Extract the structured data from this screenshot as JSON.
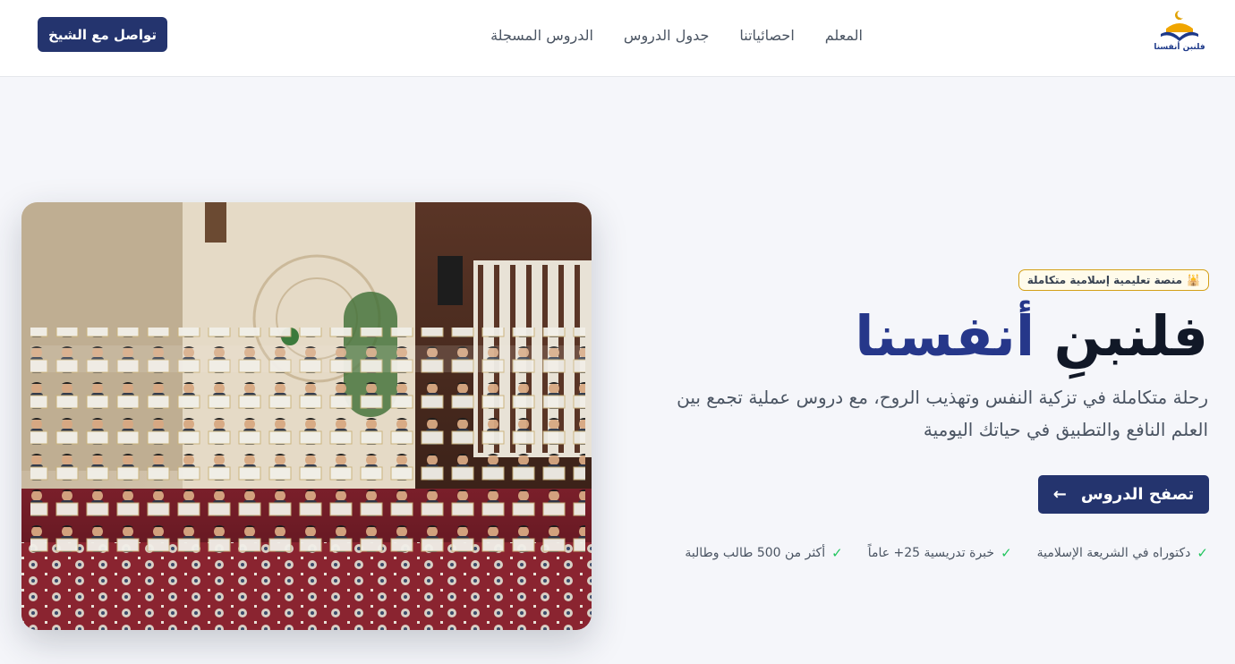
{
  "nav": {
    "logo_text": "فلنبن أنفسنا",
    "links": [
      "المعلم",
      "احصائياتنا",
      "جدول الدروس",
      "الدروس المسجلة"
    ],
    "contact_label": "تواصل مع الشيخ"
  },
  "hero": {
    "badge_icon": "🕌",
    "badge": "منصة تعليمية إسلامية متكاملة",
    "title_part1": "فلنبنِ",
    "title_part2": "أنفسنا",
    "description": "رحلة متكاملة في تزكية النفس وتهذيب الروح، مع دروس عملية تجمع بين العلم النافع والتطبيق في حياتك اليومية",
    "cta_label": "تصفح الدروس",
    "cta_icon": "arrow-left-icon",
    "features": [
      "دكتوراه في الشريعة الإسلامية",
      "خبرة تدريسية 25+ عاماً",
      "أكثر من 500 طالب وطالبة"
    ]
  },
  "colors": {
    "primary": "#24346e",
    "accent_title": "#26378a",
    "badge_border": "#d4a017",
    "check": "#22c55e",
    "background": "#f5f6fa"
  }
}
